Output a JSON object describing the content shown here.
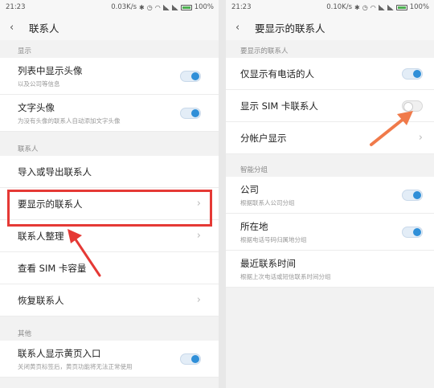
{
  "left": {
    "status": {
      "time": "21:23",
      "speed": "0.03K/s",
      "battery": "100%"
    },
    "title": "联系人",
    "sections": [
      {
        "header": "显示"
      },
      {
        "header": "联系人"
      },
      {
        "header": "其他"
      }
    ],
    "items": {
      "show_avatar": {
        "label": "列表中显示头像",
        "sub": "以及公司等信息"
      },
      "text_avatar": {
        "label": "文字头像",
        "sub": "为没有头像的联系人自动添加文字头像"
      },
      "import_export": {
        "label": "导入或导出联系人"
      },
      "contacts_to_display": {
        "label": "要显示的联系人"
      },
      "organize": {
        "label": "联系人整理"
      },
      "sim_capacity": {
        "label": "查看 SIM 卡容量"
      },
      "restore": {
        "label": "恢复联系人"
      },
      "yellow_pages": {
        "label": "联系人显示黄页入口",
        "sub": "关闭黄页标签后，黄页功能将无法正常使用"
      }
    }
  },
  "right": {
    "status": {
      "time": "21:23",
      "speed": "0.10K/s",
      "battery": "100%"
    },
    "title": "要显示的联系人",
    "sections": [
      {
        "header": "要显示的联系人"
      },
      {
        "header": "智能分组"
      }
    ],
    "items": {
      "phone_only": {
        "label": "仅显示有电话的人"
      },
      "sim_contacts": {
        "label": "显示 SIM 卡联系人"
      },
      "account_display": {
        "label": "分帐户显示"
      },
      "company": {
        "label": "公司",
        "sub": "根据联系人公司分组"
      },
      "location": {
        "label": "所在地",
        "sub": "根据电话号码归属地分组"
      },
      "recent": {
        "label": "最近联系时间",
        "sub": "根据上次电话或短信联系时间分组"
      }
    }
  },
  "colors": {
    "toggle_on": "#2f8fd8",
    "highlight": "#e53935",
    "arrow_left": "#e53935",
    "arrow_right": "#f07a4a"
  }
}
